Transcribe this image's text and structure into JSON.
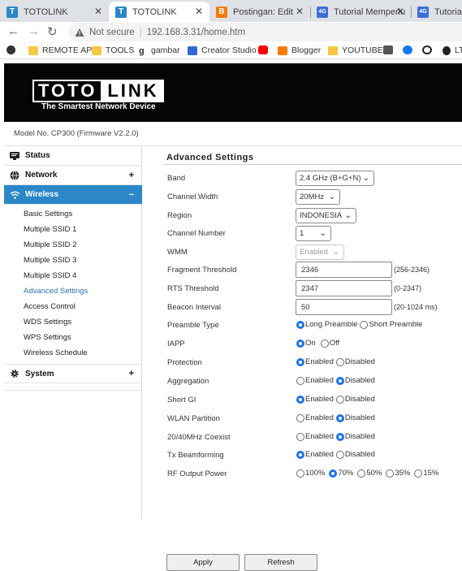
{
  "browser": {
    "tabs": [
      {
        "title": "TOTOLINK",
        "icon": "totolink-icon",
        "active": false
      },
      {
        "title": "TOTOLINK",
        "icon": "totolink-icon",
        "active": true
      },
      {
        "title": "Postingan: Edit",
        "icon": "blogger-icon",
        "active": false
      },
      {
        "title": "Tutorial Memperlua",
        "icon": "tab-site-icon",
        "active": false
      },
      {
        "title": "Tutorial M",
        "icon": "tab-site-icon",
        "active": false
      }
    ],
    "security_label": "Not secure",
    "url": "192.168.3.31/home.htm",
    "bookmarks": [
      {
        "label": "",
        "icon": "app-icon"
      },
      {
        "label": "REMOTE AP",
        "icon": "folder-icon"
      },
      {
        "label": "TOOLS",
        "icon": "folder-icon"
      },
      {
        "label": "gambar",
        "icon": "gambar-icon"
      },
      {
        "label": "Creator Studio",
        "icon": "creator-studio-icon"
      },
      {
        "label": "",
        "icon": "youtube-icon"
      },
      {
        "label": "Blogger",
        "icon": "blogger-icon"
      },
      {
        "label": "YOUTUBE",
        "icon": "folder-icon"
      },
      {
        "label": "",
        "icon": "bookmark-icon"
      },
      {
        "label": "",
        "icon": "facebook-icon"
      },
      {
        "label": "",
        "icon": "whatsapp-icon"
      },
      {
        "label": "LT",
        "icon": "tab-site-icon"
      }
    ]
  },
  "header": {
    "logo_left": "TOTO",
    "logo_right": "LINK",
    "tagline": "The Smartest Network Device",
    "model": "Model No. CP300 (Firmware V2.2.0)"
  },
  "sidebar": {
    "sections": [
      {
        "label": "Status",
        "icon": "status-icon",
        "sign": ""
      },
      {
        "label": "Network",
        "icon": "globe-icon",
        "sign": "+"
      },
      {
        "label": "Wireless",
        "icon": "wifi-icon",
        "sign": "−"
      },
      {
        "label": "System",
        "icon": "gear-icon",
        "sign": "+"
      }
    ],
    "wireless_items": [
      "Basic Settings",
      "Multiple SSID 1",
      "Multiple SSID 2",
      "Multiple SSID 3",
      "Multiple SSID 4",
      "Advanced Settings",
      "Access Control",
      "WDS Settings",
      "WPS Settings",
      "Wireless Schedule"
    ],
    "active_item": "Advanced Settings"
  },
  "content": {
    "title": "Advanced Settings",
    "fields": {
      "band": {
        "label": "Band",
        "value": "2.4 GHz (B+G+N)"
      },
      "channel_width": {
        "label": "Channel Width",
        "value": "20MHz"
      },
      "region": {
        "label": "Region",
        "value": "INDONESIA"
      },
      "channel_number": {
        "label": "Channel Number",
        "value": "1"
      },
      "wmm": {
        "label": "WMM",
        "value": "Enabled"
      },
      "fragment": {
        "label": "Fragment Threshold",
        "value": "2346",
        "hint": "(256-2346)"
      },
      "rts": {
        "label": "RTS Threshold",
        "value": "2347",
        "hint": "(0-2347)"
      },
      "beacon": {
        "label": "Beacon Interval",
        "value": "50",
        "hint": "(20-1024 ms)"
      }
    },
    "radios": [
      {
        "label": "Preamble Type",
        "options": [
          "Long Preamble",
          "Short Preamble"
        ],
        "selected": 0
      },
      {
        "label": "IAPP",
        "options": [
          "On",
          "Off"
        ],
        "selected": 0
      },
      {
        "label": "Protection",
        "options": [
          "Enabled",
          "Disabled"
        ],
        "selected": 0
      },
      {
        "label": "Aggregation",
        "options": [
          "Enabled",
          "Disabled"
        ],
        "selected": 1
      },
      {
        "label": "Short GI",
        "options": [
          "Enabled",
          "Disabled"
        ],
        "selected": 0
      },
      {
        "label": "WLAN Partition",
        "options": [
          "Enabled",
          "Disabled"
        ],
        "selected": 1
      },
      {
        "label": "20/40MHz Coexist",
        "options": [
          "Enabled",
          "Disabled"
        ],
        "selected": 1
      },
      {
        "label": "Tx Beamforming",
        "options": [
          "Enabled",
          "Disabled"
        ],
        "selected": 0
      },
      {
        "label": "RF Output Power",
        "options": [
          "100%",
          "70%",
          "50%",
          "35%",
          "15%"
        ],
        "selected": 1
      }
    ],
    "apply_label": "Apply",
    "refresh_label": "Refresh"
  },
  "colors": {
    "accent": "#2b87c8",
    "radio_on": "#1a73e8",
    "banner": "#050505"
  }
}
